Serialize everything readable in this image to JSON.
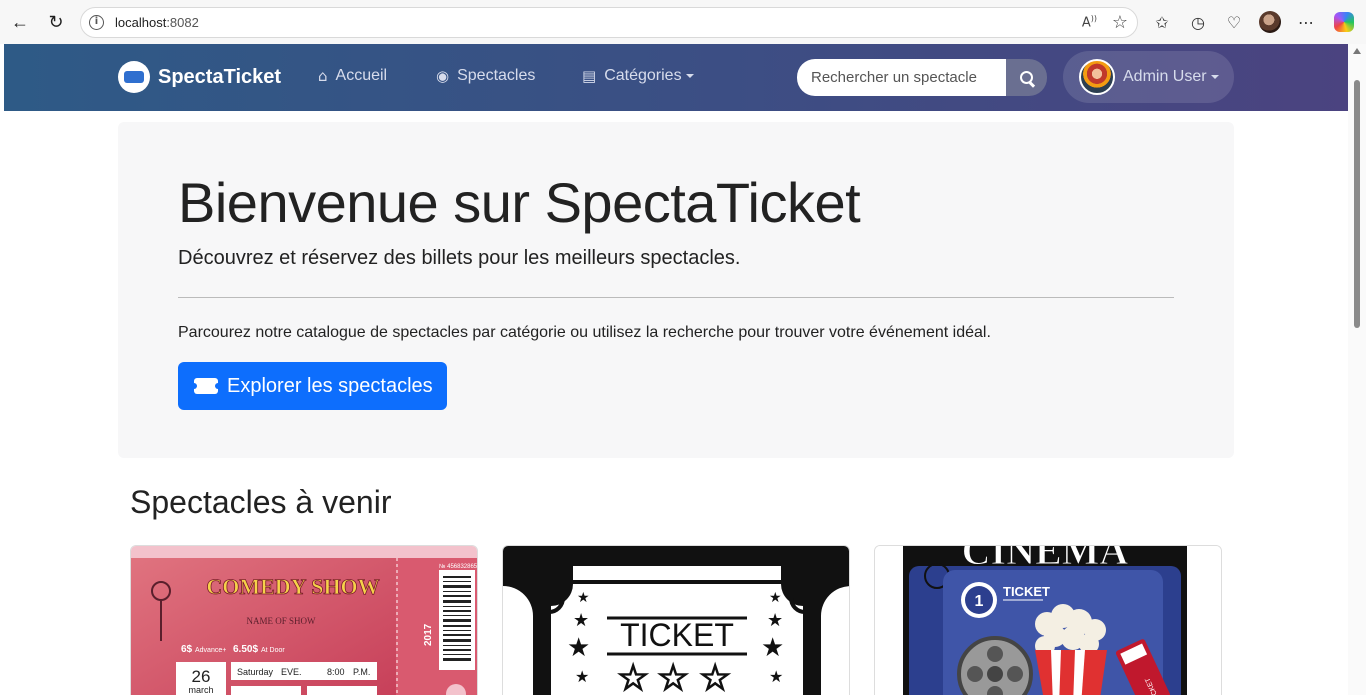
{
  "browser": {
    "url_host": "localhost",
    "url_port": ":8082"
  },
  "navbar": {
    "brand": "SpectaTicket",
    "links": [
      {
        "label": "Accueil"
      },
      {
        "label": "Spectacles"
      },
      {
        "label": "Catégories"
      }
    ],
    "search_placeholder": "Rechercher un spectacle",
    "user_name": "Admin User"
  },
  "hero": {
    "title": "Bienvenue sur SpectaTicket",
    "lead": "Découvrez et réservez des billets pour les meilleurs spectacles.",
    "text": "Parcourez notre catalogue de spectacles par catégorie ou utilisez la recherche pour trouver votre événement idéal.",
    "button_label": "Explorer les spectacles"
  },
  "upcoming": {
    "title": "Spectacles à venir",
    "cards": [
      {
        "image_text": [
          "COMEDY SHOW",
          "NAME OF SHOW",
          "6$",
          "Advance+",
          "6.50$",
          "At Door",
          "26",
          "march",
          "Saturday",
          "EVE.",
          "8:00",
          "P.M.",
          "2017",
          "№ 456832865"
        ]
      },
      {
        "image_text": [
          "TICKET"
        ]
      },
      {
        "image_text": [
          "CINEMA",
          "1",
          "TICKET"
        ]
      }
    ]
  },
  "colors": {
    "navbar_start": "#2e5a86",
    "navbar_end": "#4b4380",
    "primary": "#0d6efd",
    "hero_bg": "#f7f7f8"
  }
}
